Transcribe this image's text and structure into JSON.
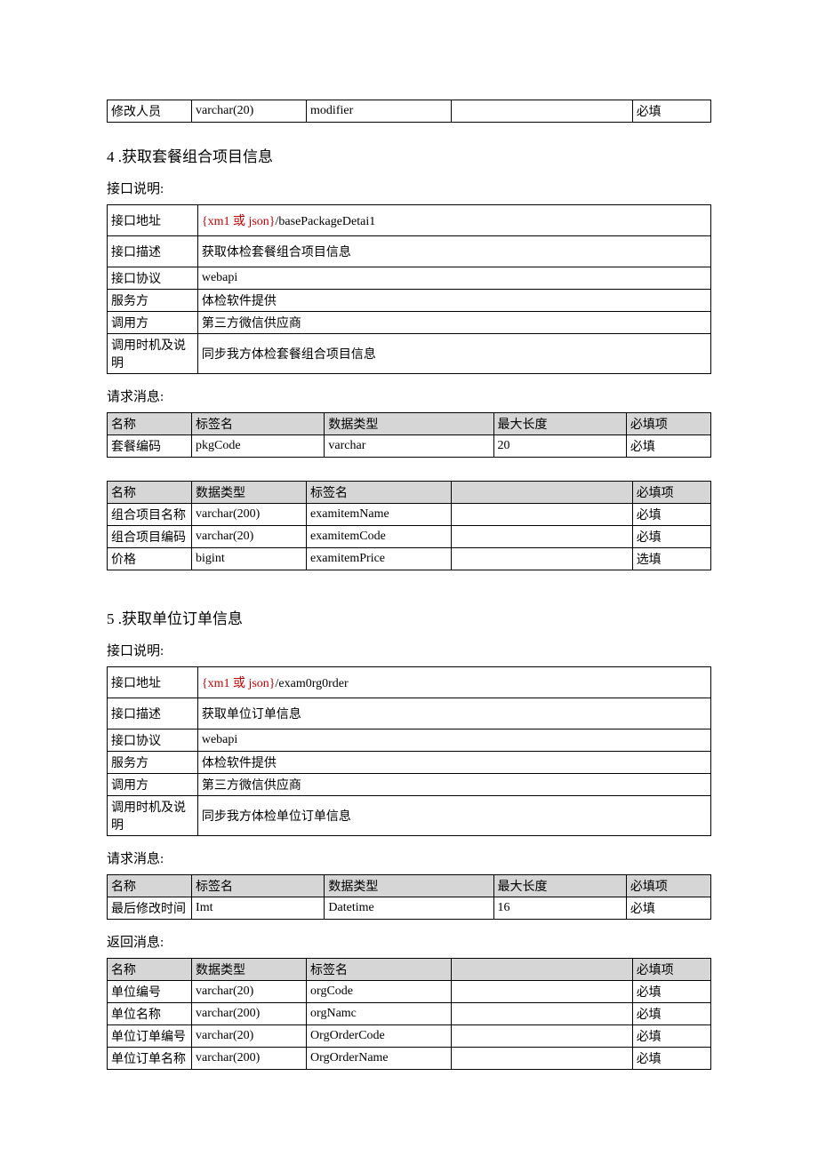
{
  "top_table": {
    "row": [
      "修改人员",
      "varchar(20)",
      "modifier",
      "",
      "必填"
    ]
  },
  "section4": {
    "title": "4  .获取套餐组合项目信息",
    "api_label": "接口说明:",
    "api": [
      {
        "k": "接口地址",
        "prefix": "{xm1 或 json}",
        "suffix": "/basePackageDetai1",
        "tall": true
      },
      {
        "k": "接口描述",
        "v": "获取体检套餐组合项目信息",
        "tall": true
      },
      {
        "k": "接口协议",
        "v": "webapi"
      },
      {
        "k": "服务方",
        "v": "体检软件提供"
      },
      {
        "k": "调用方",
        "v": "第三方微信供应商"
      },
      {
        "k": "调用时机及说明",
        "v": "同步我方体检套餐组合项目信息"
      }
    ],
    "req_label": "请求消息:",
    "req_headers": [
      "名称",
      "标签名",
      "数据类型",
      "最大长度",
      "必填项"
    ],
    "req_rows": [
      [
        "套餐编码",
        "pkgCode",
        "varchar",
        "20",
        "必填"
      ]
    ],
    "resp_headers": [
      "名称",
      "数据类型",
      "标签名",
      "",
      "必填项"
    ],
    "resp_rows": [
      [
        "组合项目名称",
        "varchar(200)",
        "examitemName",
        "",
        "必填"
      ],
      [
        "组合项目编码",
        "varchar(20)",
        "examitemCode",
        "",
        "必填"
      ],
      [
        "价格",
        "bigint",
        "examitemPrice",
        "",
        "选填"
      ]
    ]
  },
  "section5": {
    "title": "5  .获取单位订单信息",
    "api_label": "接口说明:",
    "api": [
      {
        "k": "接口地址",
        "prefix": "{xm1 或 json}",
        "suffix": "/exam0rg0rder",
        "tall": true
      },
      {
        "k": "接口描述",
        "v": "获取单位订单信息",
        "tall": true
      },
      {
        "k": "接口协议",
        "v": "webapi"
      },
      {
        "k": "服务方",
        "v": "体检软件提供"
      },
      {
        "k": "调用方",
        "v": "第三方微信供应商"
      },
      {
        "k": "调用时机及说明",
        "v": "同步我方体检单位订单信息"
      }
    ],
    "req_label": "请求消息:",
    "req_headers": [
      "名称",
      "标签名",
      "数据类型",
      "最大长度",
      "必填项"
    ],
    "req_rows": [
      [
        "最后修改时间",
        "Imt",
        "Datetime",
        "16",
        "必填"
      ]
    ],
    "resp_label": "返回消息:",
    "resp_headers": [
      "名称",
      "数据类型",
      "标签名",
      "",
      "必填项"
    ],
    "resp_rows": [
      [
        "单位编号",
        "varchar(20)",
        "orgCode",
        "",
        "必填"
      ],
      [
        "单位名称",
        "varchar(200)",
        "orgNamc",
        "",
        "必填"
      ],
      [
        "单位订单编号",
        "varchar(20)",
        "OrgOrderCode",
        "",
        "必填"
      ],
      [
        "单位订单名称",
        "varchar(200)",
        "OrgOrderName",
        "",
        "必填"
      ]
    ]
  }
}
